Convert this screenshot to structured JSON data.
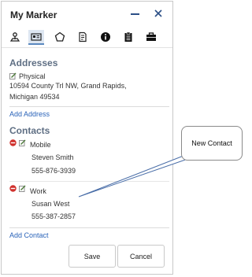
{
  "window": {
    "title": "My Marker"
  },
  "tabs": [
    {
      "name": "tab-location",
      "icon": "location-pin-icon"
    },
    {
      "name": "tab-contact-card",
      "icon": "contact-card-icon",
      "active": true
    },
    {
      "name": "tab-shape",
      "icon": "pentagon-icon"
    },
    {
      "name": "tab-notes",
      "icon": "document-edit-icon"
    },
    {
      "name": "tab-info",
      "icon": "info-icon"
    },
    {
      "name": "tab-clipboard",
      "icon": "clipboard-icon"
    },
    {
      "name": "tab-briefcase",
      "icon": "briefcase-icon"
    }
  ],
  "addresses": {
    "heading": "Addresses",
    "items": [
      {
        "label": "Physical",
        "line1": "10594 County Trl NW, Grand Rapids,",
        "line2": "Michigan 49534"
      }
    ],
    "add_link": "Add Address"
  },
  "contacts": {
    "heading": "Contacts",
    "items": [
      {
        "type": "Mobile",
        "name": "Steven Smith",
        "phone": "555-876-3939"
      },
      {
        "type": "Work",
        "name": "Susan West",
        "phone": "555-387-2857"
      }
    ],
    "add_link": "Add Contact"
  },
  "buttons": {
    "save": "Save",
    "cancel": "Cancel"
  },
  "callout": {
    "text": "New Contact"
  },
  "colors": {
    "heading": "#5f6f84",
    "link": "#2a63b9",
    "delete": "#d0312d",
    "accent": "#2b4f86"
  }
}
